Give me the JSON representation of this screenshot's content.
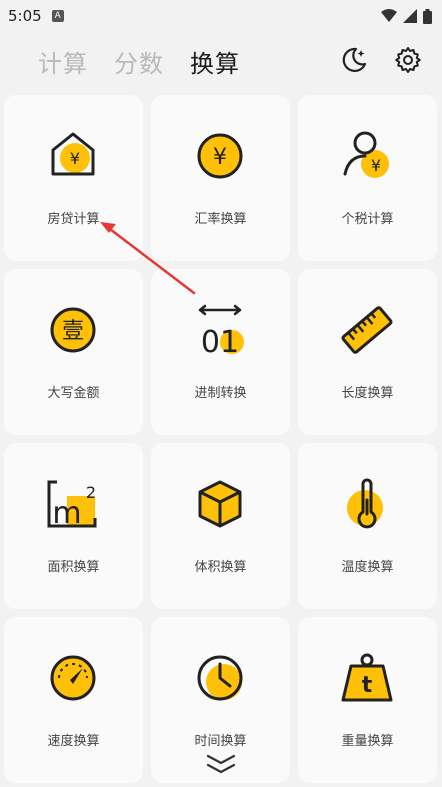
{
  "status_bar": {
    "time": "5:05",
    "app_icon_letter": "A"
  },
  "header": {
    "tabs": [
      {
        "label": "计算"
      },
      {
        "label": "分数"
      },
      {
        "label": "换算"
      }
    ],
    "active_tab": "换算",
    "theme_icon": "moon-icon",
    "settings_icon": "gear-icon"
  },
  "tools": [
    {
      "label": "房贷计算",
      "icon": "house-yen-icon"
    },
    {
      "label": "汇率换算",
      "icon": "currency-yen-icon"
    },
    {
      "label": "个税计算",
      "icon": "person-yen-icon"
    },
    {
      "label": "大写金额",
      "icon": "chinese-numeral-coin-icon"
    },
    {
      "label": "进制转换",
      "icon": "binary-arrows-icon"
    },
    {
      "label": "长度换算",
      "icon": "ruler-icon"
    },
    {
      "label": "面积换算",
      "icon": "square-meter-icon"
    },
    {
      "label": "体积换算",
      "icon": "cube-icon"
    },
    {
      "label": "温度换算",
      "icon": "thermometer-icon"
    },
    {
      "label": "速度换算",
      "icon": "speedometer-icon"
    },
    {
      "label": "时间换算",
      "icon": "clock-icon"
    },
    {
      "label": "重量换算",
      "icon": "weight-icon"
    }
  ],
  "icon_text": {
    "yen": "¥",
    "chinese_one": "壹",
    "binary": "01",
    "squared": "2",
    "weight_t": "t"
  },
  "colors": {
    "accent": "#FFC107",
    "icon_stroke": "#222222",
    "annotation_arrow": "#E53935"
  }
}
